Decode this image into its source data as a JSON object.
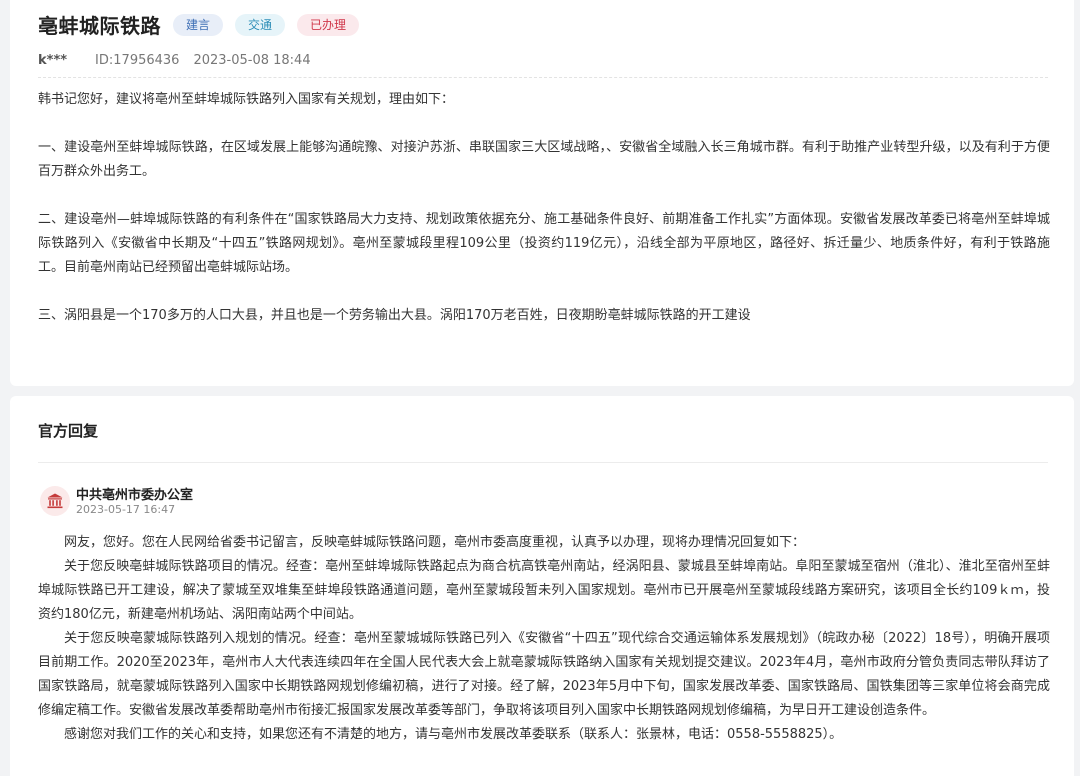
{
  "post": {
    "title": "亳蚌城际铁路",
    "tags": [
      "建言",
      "交通",
      "已办理"
    ],
    "user": "k***",
    "id_label": "ID:17956436",
    "datetime": "2023-05-08 18:44",
    "paragraphs": [
      "韩书记您好，建议将亳州至蚌埠城际铁路列入国家有关规划，理由如下：",
      "一、建设亳州至蚌埠城际铁路，在区域发展上能够沟通皖豫、对接沪苏浙、串联国家三大区域战略，、安徽省全域融入长三角城市群。有利于助推产业转型升级，以及有利于方便百万群众外出务工。",
      "二、建设亳州—蚌埠城际铁路的有利条件在“国家铁路局大力支持、规划政策依据充分、施工基础条件良好、前期准备工作扎实”方面体现。安徽省发展改革委已将亳州至蚌埠城际铁路列入《安徽省中长期及“十四五”铁路网规划》。亳州至蒙城段里程109公里（投资约119亿元），沿线全部为平原地区，路径好、拆迁量少、地质条件好，有利于铁路施工。目前亳州南站已经预留出亳蚌城际站场。",
      "三、涡阳县是一个170多万的人口大县，并且也是一个劳务输出大县。涡阳170万老百姓，日夜期盼亳蚌城际铁路的开工建设"
    ]
  },
  "reply": {
    "heading": "官方回复",
    "org_name": "中共亳州市委办公室",
    "org_date": "2023-05-17 16:47",
    "paragraphs": [
      "网友，您好。您在人民网给省委书记留言，反映亳蚌城际铁路问题，亳州市委高度重视，认真予以办理，现将办理情况回复如下：",
      "关于您反映亳蚌城际铁路项目的情况。经查：亳州至蚌埠城际铁路起点为商合杭高铁亳州南站，经涡阳县、蒙城县至蚌埠南站。阜阳至蒙城至宿州（淮北）、淮北至宿州至蚌埠城际铁路已开工建设，解决了蒙城至双堆集至蚌埠段铁路通道问题，亳州至蒙城段暂未列入国家规划。亳州市已开展亳州至蒙城段线路方案研究，该项目全长约109ｋｍ，投资约180亿元，新建亳州机场站、涡阳南站两个中间站。",
      "关于您反映亳蒙城际铁路列入规划的情况。经查：亳州至蒙城城际铁路已列入《安徽省“十四五”现代综合交通运输体系发展规划》（皖政办秘〔2022〕18号），明确开展项目前期工作。2020至2023年，亳州市人大代表连续四年在全国人民代表大会上就亳蒙城际铁路纳入国家有关规划提交建议。2023年4月，亳州市政府分管负责同志带队拜访了国家铁路局，就亳蒙城际铁路列入国家中长期铁路网规划修编初稿，进行了对接。经了解，2023年5月中下旬，国家发展改革委、国家铁路局、国铁集团等三家单位将会商完成修编定稿工作。安徽省发展改革委帮助亳州市衔接汇报国家发展改革委等部门，争取将该项目列入国家中长期铁路网规划修编稿，为早日开工建设创造条件。",
      "感谢您对我们工作的关心和支持，如果您还有不清楚的地方，请与亳州市发展改革委联系（联系人：张景林，电话：0558-5558825）。"
    ]
  },
  "colors": {
    "tag_blue_bg": "#e8eef8",
    "tag_cyan_bg": "#e6f4f9",
    "tag_red_bg": "#fbe9ec",
    "org_icon": "#c53b3b"
  },
  "icons": {
    "org": "building-columns-icon"
  }
}
